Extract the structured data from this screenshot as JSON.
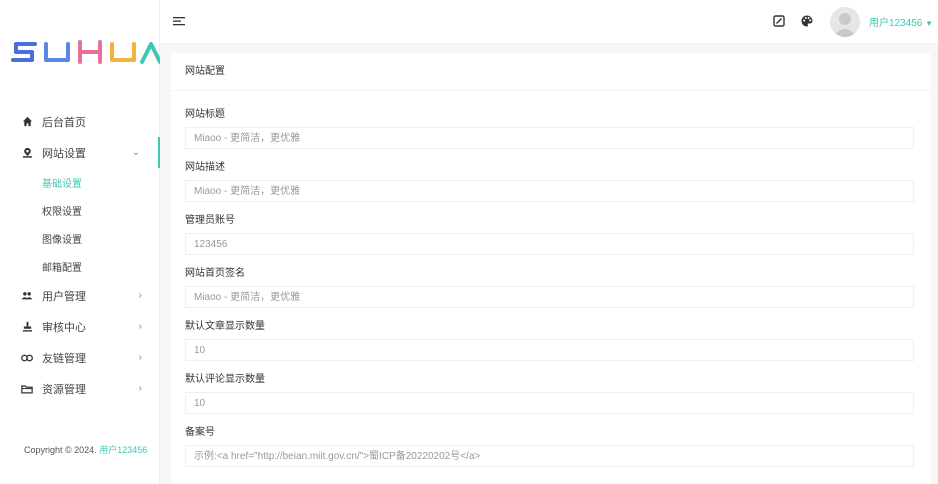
{
  "brand": {
    "logo_text": "SUHUA"
  },
  "sidebar": {
    "items": [
      {
        "label": "后台首页",
        "icon": "home-icon"
      },
      {
        "label": "网站设置",
        "icon": "pin-icon",
        "expanded": true,
        "children": [
          "基础设置",
          "权限设置",
          "图像设置",
          "邮箱配置"
        ],
        "active_child": "基础设置"
      },
      {
        "label": "用户管理",
        "icon": "users-icon"
      },
      {
        "label": "审核中心",
        "icon": "stamp-icon"
      },
      {
        "label": "友链管理",
        "icon": "link-icon"
      },
      {
        "label": "资源管理",
        "icon": "folder-icon"
      }
    ],
    "copyright_prefix": "Copyright © 2024.",
    "copyright_user": "用户123456"
  },
  "topbar": {
    "username": "用户123456"
  },
  "card": {
    "title": "网站配置",
    "fields": [
      {
        "label": "网站标题",
        "placeholder": "Miaoo - 更简洁，更优雅"
      },
      {
        "label": "网站描述",
        "placeholder": "Miaoo - 更简洁，更优雅"
      },
      {
        "label": "管理员账号",
        "placeholder": "123456"
      },
      {
        "label": "网站首页签名",
        "placeholder": "Miaoo - 更简洁，更优雅"
      },
      {
        "label": "默认文章显示数量",
        "placeholder": "10"
      },
      {
        "label": "默认评论显示数量",
        "placeholder": "10"
      },
      {
        "label": "备案号",
        "placeholder": "示例:<a href=\"http://beian.miit.gov.cn/\">蜀ICP备20220202号</a>"
      }
    ]
  },
  "colors": {
    "accent": "#3ec7b2",
    "logo_blue": "#4a6fd8",
    "logo_pink": "#e8709a",
    "logo_yellow": "#f0b43c",
    "logo_green": "#3ec7b2"
  }
}
